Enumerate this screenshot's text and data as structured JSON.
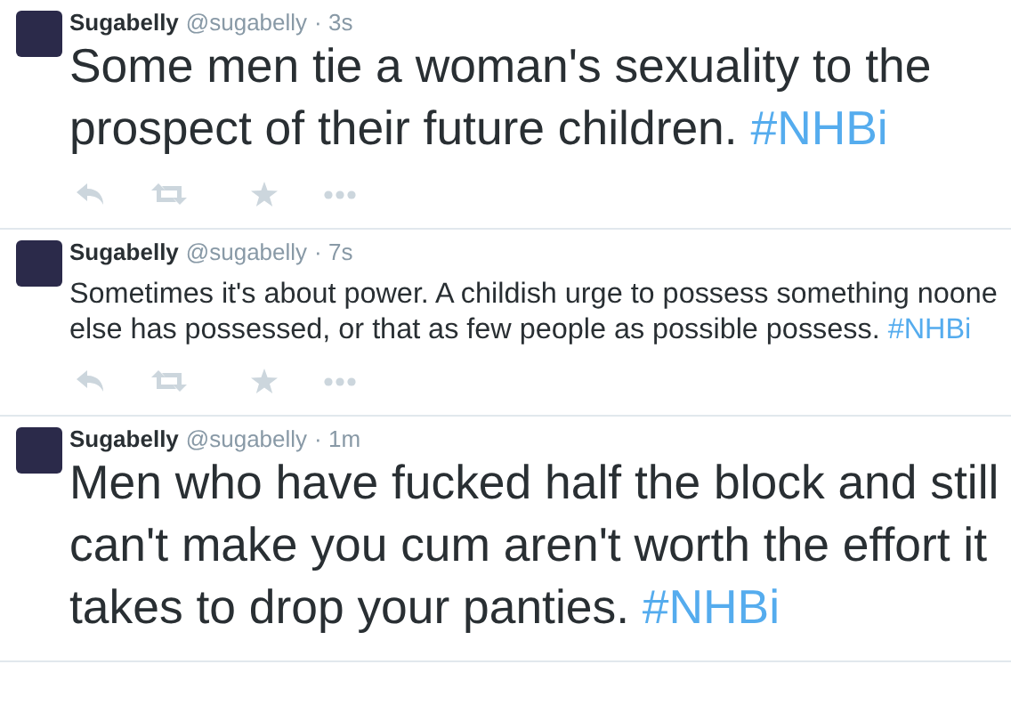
{
  "tweets": [
    {
      "name": "Sugabelly",
      "handle": "@sugabelly",
      "time": "· 3s",
      "kind": "large",
      "text": "Some men tie a woman's sexuality to the prospect of their future children.",
      "hashtag": "#NHBi",
      "actions": true
    },
    {
      "name": "Sugabelly",
      "handle": "@sugabelly",
      "time": "· 7s",
      "kind": "normal",
      "text": "Sometimes it's about power. A childish urge to possess something noone else has possessed, or that as few people as possible possess.",
      "hashtag": "#NHBi",
      "actions": true
    },
    {
      "name": "Sugabelly",
      "handle": "@sugabelly",
      "time": "· 1m",
      "kind": "large",
      "text": "Men who have fucked half the block and still can't make you cum aren't worth the effort it takes to drop your panties.",
      "hashtag": "#NHBi",
      "actions": false
    }
  ]
}
